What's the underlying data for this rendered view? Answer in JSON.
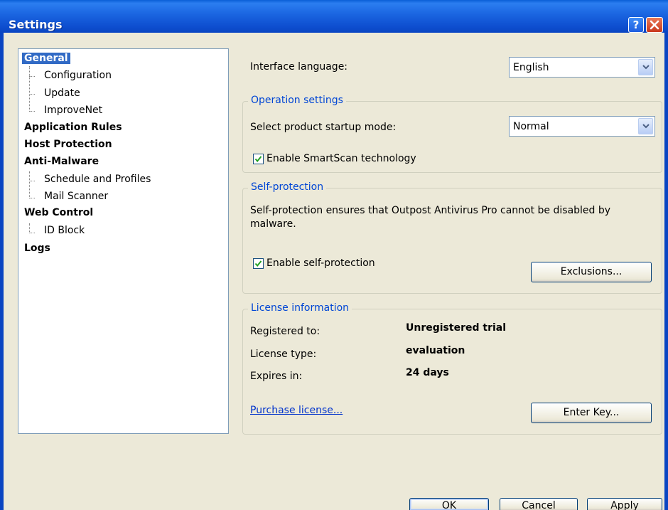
{
  "window": {
    "title": "Settings"
  },
  "tree": {
    "items": [
      {
        "label": "General",
        "bold": true,
        "selected": true
      },
      {
        "label": "Configuration"
      },
      {
        "label": "Update"
      },
      {
        "label": "ImproveNet"
      },
      {
        "label": "Application Rules",
        "bold": true
      },
      {
        "label": "Host Protection",
        "bold": true
      },
      {
        "label": "Anti-Malware",
        "bold": true
      },
      {
        "label": "Schedule and Profiles"
      },
      {
        "label": "Mail Scanner"
      },
      {
        "label": "Web Control",
        "bold": true
      },
      {
        "label": "ID Block"
      },
      {
        "label": "Logs",
        "bold": true
      }
    ]
  },
  "general": {
    "language_label": "Interface language:",
    "language_value": "English"
  },
  "operation": {
    "title": "Operation settings",
    "startup_label": "Select product startup mode:",
    "startup_value": "Normal",
    "smartscan_label": "Enable SmartScan technology",
    "smartscan_checked": true
  },
  "selfprotection": {
    "title": "Self-protection",
    "description": "Self-protection ensures that Outpost Antivirus Pro cannot be disabled by malware.",
    "enable_label": "Enable self-protection",
    "enable_checked": true,
    "exclusions_button": "Exclusions..."
  },
  "license": {
    "title": "License information",
    "registered_label": "Registered to:",
    "registered_value": "Unregistered trial",
    "type_label": "License type:",
    "type_value": "evaluation",
    "expires_label": "Expires in:",
    "expires_value": "24 days",
    "purchase_link": "Purchase license...",
    "enter_key_button": "Enter Key..."
  },
  "footer": {
    "ok": "OK",
    "cancel": "Cancel",
    "apply": "Apply"
  },
  "colors": {
    "titlebar": "#0a45c2",
    "selection": "#316ac5",
    "group_title": "#0046d5",
    "link": "#0033cc"
  }
}
